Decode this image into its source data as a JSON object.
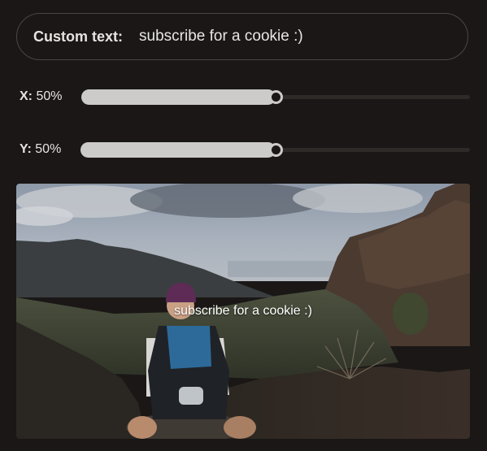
{
  "custom_text": {
    "label": "Custom text:",
    "value": "subscribe for a cookie :)"
  },
  "sliders": {
    "x": {
      "label": "X:",
      "value_text": "50%",
      "value": 50
    },
    "y": {
      "label": "Y:",
      "value_text": "50%",
      "value": 50
    }
  },
  "preview": {
    "overlay_text": "subscribe for a cookie :)"
  }
}
